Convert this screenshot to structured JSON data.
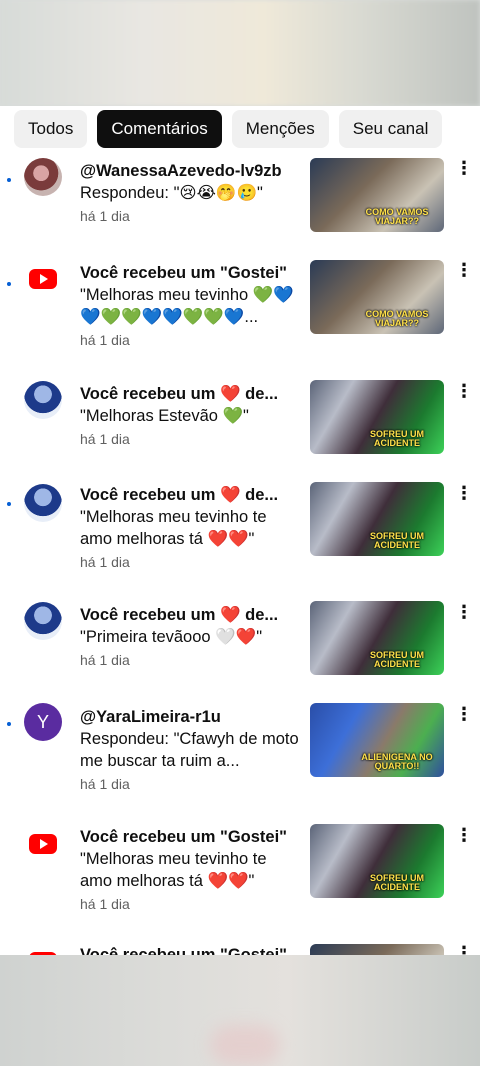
{
  "tabs": [
    {
      "label": "Todos",
      "active": false
    },
    {
      "label": "Comentários",
      "active": true
    },
    {
      "label": "Menções",
      "active": false
    },
    {
      "label": "Seu canal",
      "active": false
    }
  ],
  "notifications": [
    {
      "title": "@WanessaAzevedo-lv9zb",
      "text": "Respondeu: \"😢😭🤭🥲\"",
      "time": "há 1 dia",
      "avatar": "user-photo",
      "thumbnail_caption": "COMO VAMOS VIAJAR??"
    },
    {
      "title": "Você recebeu um \"Gostei\"",
      "text": "\"Melhoras meu tevinho 💚💙💙💚💚💙💙💚💚💙...",
      "time": "há 1 dia",
      "avatar": "youtube-logo",
      "thumbnail_caption": "COMO VAMOS VIAJAR??"
    },
    {
      "title": "Você recebeu um ❤️ de...",
      "text": "\"Melhoras Estevão 💚\"",
      "time": "há 1 dia",
      "avatar": "user-photo",
      "thumbnail_caption": "SOFREU UM ACIDENTE"
    },
    {
      "title": "Você recebeu um ❤️ de...",
      "text": "\"Melhoras meu tevinho te amo melhoras tá ❤️❤️\"",
      "time": "há 1 dia",
      "avatar": "user-photo",
      "thumbnail_caption": "SOFREU UM ACIDENTE"
    },
    {
      "title": "Você recebeu um ❤️ de...",
      "text": "\"Primeira tevãooo 🤍❤️\"",
      "time": "há 1 dia",
      "avatar": "user-photo",
      "thumbnail_caption": "SOFREU UM ACIDENTE"
    },
    {
      "title": "@YaraLimeira-r1u",
      "text": "Respondeu: \"Cfawyh de moto me buscar ta ruim a...",
      "time": "há 1 dia",
      "avatar": "letter-avatar",
      "avatar_letter": "Y",
      "thumbnail_caption": "ALIENIGENA NO QUARTO!!"
    },
    {
      "title": "Você recebeu um \"Gostei\"",
      "text": "\"Melhoras meu tevinho te amo melhoras tá ❤️❤️\"",
      "time": "há 1 dia",
      "avatar": "youtube-logo",
      "thumbnail_caption": "SOFREU UM ACIDENTE"
    },
    {
      "title": "Você recebeu um \"Gostei\"",
      "text": "",
      "time": "",
      "avatar": "youtube-logo",
      "thumbnail_caption": ""
    }
  ],
  "colors": {
    "accent": "#0f0f0f",
    "unread_dot": "#065fd4",
    "youtube_red": "#ff0000"
  },
  "icons": {
    "more": "more-vert-icon"
  }
}
